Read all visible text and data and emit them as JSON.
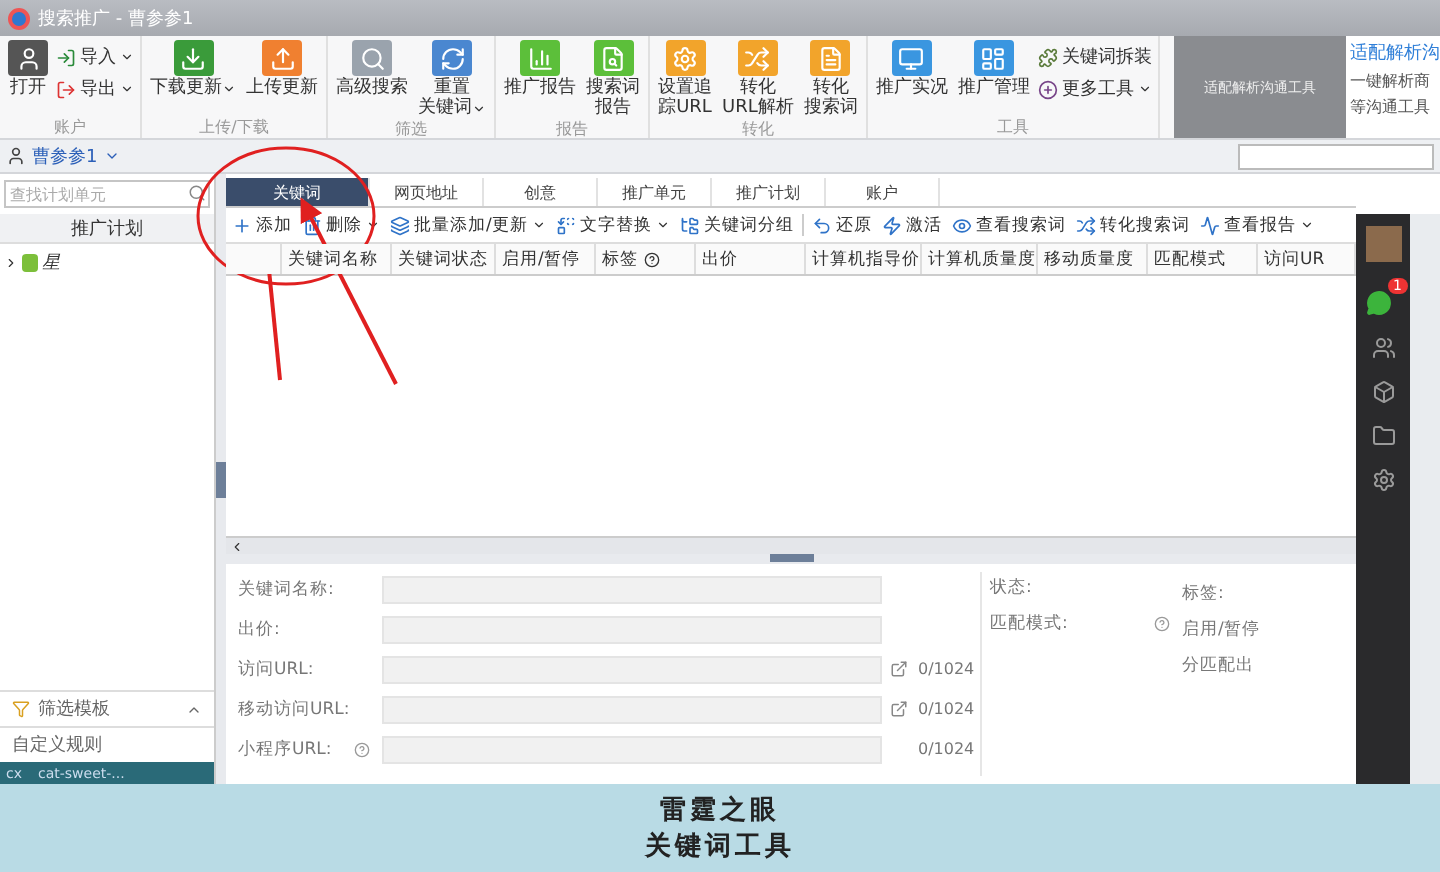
{
  "window": {
    "title": "搜索推广 - 曹参参1"
  },
  "ribbon": {
    "groups": [
      {
        "label": "账户",
        "buttons": [
          {
            "lines": [
              "打开"
            ],
            "kind": "large",
            "dropdown": false
          },
          {
            "lines": [
              "导入"
            ],
            "kind": "small",
            "dropdown": true
          },
          {
            "lines": [
              "导出"
            ],
            "kind": "small",
            "dropdown": true
          }
        ]
      },
      {
        "label": "上传/下载",
        "buttons": [
          {
            "lines": [
              "下载更新"
            ],
            "kind": "large",
            "dropdown": true
          },
          {
            "lines": [
              "上传更新"
            ],
            "kind": "large",
            "dropdown": false
          }
        ]
      },
      {
        "label": "筛选",
        "buttons": [
          {
            "lines": [
              "高级搜索"
            ],
            "kind": "large",
            "dropdown": false
          },
          {
            "lines": [
              "重置",
              "关键词"
            ],
            "kind": "large",
            "dropdown": true
          }
        ]
      },
      {
        "label": "报告",
        "buttons": [
          {
            "lines": [
              "推广报告"
            ],
            "kind": "large",
            "dropdown": false
          },
          {
            "lines": [
              "搜索词",
              "报告"
            ],
            "kind": "large",
            "dropdown": false
          }
        ]
      },
      {
        "label": "转化",
        "buttons": [
          {
            "lines": [
              "设置追",
              "踪URL"
            ],
            "kind": "large",
            "dropdown": false
          },
          {
            "lines": [
              "转化",
              "URL解析"
            ],
            "kind": "large",
            "dropdown": false
          },
          {
            "lines": [
              "转化",
              "搜索词"
            ],
            "kind": "large",
            "dropdown": false
          }
        ]
      },
      {
        "label": "工具",
        "buttons": [
          {
            "lines": [
              "推广实况"
            ],
            "kind": "large",
            "dropdown": false
          },
          {
            "lines": [
              "推广管理"
            ],
            "kind": "large",
            "dropdown": false
          },
          {
            "lines": [
              "关键词拆装"
            ],
            "kind": "small",
            "dropdown": false
          },
          {
            "lines": [
              "更多工具"
            ],
            "kind": "small",
            "dropdown": true
          }
        ]
      }
    ]
  },
  "ad": {
    "caption": "适配解析沟通工具",
    "title": "适配解析沟",
    "lines": [
      "一键解析商",
      "等沟通工具"
    ]
  },
  "account_bar": {
    "account": "曹参参1"
  },
  "left_panel": {
    "search": {
      "placeholder": "查找计划单元"
    },
    "header": "推广计划",
    "tree": [
      {
        "label": "星",
        "expanded": false
      }
    ],
    "footer_items": [
      {
        "label": "筛选模板",
        "expanded": true
      },
      {
        "label": "自定义规则"
      }
    ]
  },
  "taskbar": [
    "cx",
    "cat-sweet-..."
  ],
  "tabs": [
    {
      "label": "关键词",
      "selected": true
    },
    {
      "label": "网页地址",
      "selected": false
    },
    {
      "label": "创意",
      "selected": false
    },
    {
      "label": "推广单元",
      "selected": false
    },
    {
      "label": "推广计划",
      "selected": false
    },
    {
      "label": "账户",
      "selected": false
    }
  ],
  "toolbar": [
    {
      "label": "添加",
      "dropdown": false
    },
    {
      "label": "删除",
      "dropdown": true
    },
    {
      "label": "批量添加/更新",
      "dropdown": true
    },
    {
      "label": "文字替换",
      "dropdown": true
    },
    {
      "label": "关键词分组",
      "dropdown": false
    },
    {
      "label": "还原",
      "dropdown": false
    },
    {
      "label": "激活",
      "dropdown": false
    },
    {
      "label": "查看搜索词",
      "dropdown": false
    },
    {
      "label": "转化搜索词",
      "dropdown": false
    },
    {
      "label": "查看报告",
      "dropdown": true
    }
  ],
  "table": {
    "columns": [
      {
        "label": "关键词名称"
      },
      {
        "label": "关键词状态"
      },
      {
        "label": "启用/暂停"
      },
      {
        "label": "标签",
        "help": true
      },
      {
        "label": "出价"
      },
      {
        "label": "计算机指导价"
      },
      {
        "label": "计算机质量度"
      },
      {
        "label": "移动质量度"
      },
      {
        "label": "匹配模式"
      },
      {
        "label": "访问UR"
      }
    ]
  },
  "details": {
    "fields": [
      {
        "label": "关键词名称:",
        "help": false,
        "expand_button": false
      },
      {
        "label": "出价:",
        "help": false,
        "expand_button": false
      },
      {
        "label": "访问URL:",
        "help": false,
        "expand_button": true,
        "counter": "0/1024"
      },
      {
        "label": "移动访问URL:",
        "help": false,
        "expand_button": true,
        "counter": "0/1024"
      },
      {
        "label": "小程序URL:",
        "help": true,
        "expand_button": false,
        "counter": "0/1024"
      }
    ],
    "status": [
      {
        "label": "状态:",
        "help": false
      },
      {
        "label": "匹配模式:",
        "help": true
      }
    ],
    "extra": [
      "标签:",
      "启用/暂停",
      "分匹配出"
    ]
  },
  "dock": {
    "badge": "1"
  },
  "banner": {
    "lines": [
      "雷霆之眼",
      "关键词工具"
    ]
  }
}
